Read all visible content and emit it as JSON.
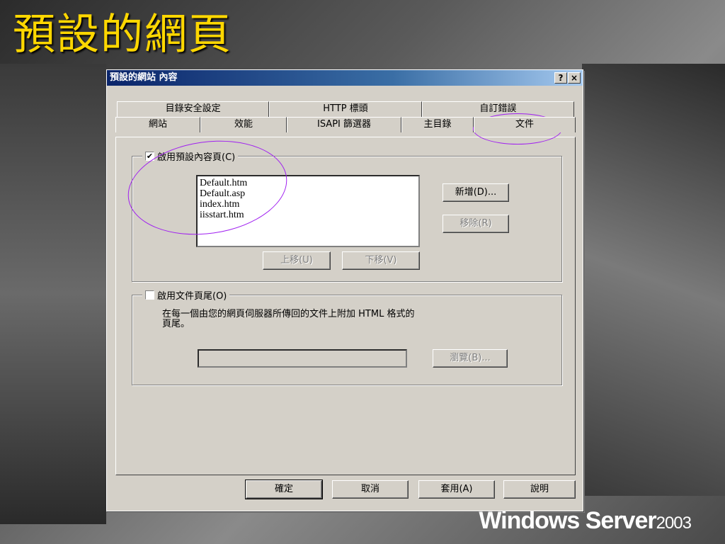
{
  "slide": {
    "title": "預設的網頁",
    "brand": "Windows Server",
    "brand_version": "2003"
  },
  "dialog": {
    "title": "預設的網站 內容",
    "help_btn": "?",
    "close_btn": "×",
    "tabs_back": [
      "目錄安全設定",
      "HTTP 標頭",
      "自訂錯誤"
    ],
    "tabs_front": [
      "網站",
      "效能",
      "ISAPI 篩選器",
      "主目錄",
      "文件"
    ],
    "active_tab": "文件",
    "default_content": {
      "checked": true,
      "check_mark": "✔",
      "label": "啟用預設內容頁(C)",
      "files": [
        "Default.htm",
        "Default.asp",
        "index.htm",
        "iisstart.htm"
      ],
      "add": "新增(D)...",
      "remove": "移除(R)",
      "move_up": "上移(U)",
      "move_down": "下移(V)"
    },
    "footer_section": {
      "checked": false,
      "label": "啟用文件頁尾(O)",
      "description_line1": "在每一個由您的網頁伺服器所傳回的文件上附加 HTML 格式的",
      "description_line2": "頁尾。",
      "path_value": "",
      "browse": "瀏覽(B)..."
    },
    "buttons": {
      "ok": "確定",
      "cancel": "取消",
      "apply": "套用(A)",
      "help": "說明"
    }
  },
  "colors": {
    "title_gold": "#ffd700",
    "titlebar_start": "#0a246a",
    "titlebar_end": "#a6caf0",
    "annotation": "#a020f0",
    "dialog_face": "#d4d0c8"
  }
}
